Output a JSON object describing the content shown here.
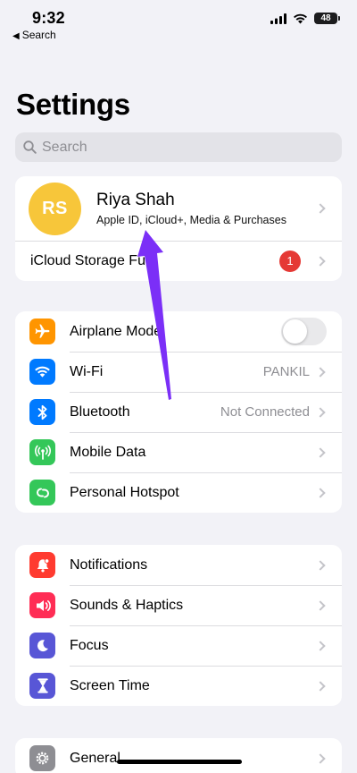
{
  "status_bar": {
    "time": "9:32",
    "back_label": "Search",
    "battery": "48",
    "icons": [
      "signal-icon",
      "wifi-icon",
      "battery-icon"
    ]
  },
  "page": {
    "title": "Settings",
    "search_placeholder": "Search"
  },
  "profile": {
    "initials": "RS",
    "name": "Riya Shah",
    "subtitle": "Apple ID, iCloud+, Media & Purchases",
    "avatar_color": "#f7c63a"
  },
  "icloud": {
    "label": "iCloud Storage Full",
    "badge": "1",
    "badge_color": "#e53935"
  },
  "group1": [
    {
      "label": "Airplane Mode",
      "icon": "airplane-icon",
      "color": "#ff9500",
      "toggle": false
    },
    {
      "label": "Wi-Fi",
      "icon": "wifi-icon",
      "color": "#007aff",
      "value": "PANKIL"
    },
    {
      "label": "Bluetooth",
      "icon": "bluetooth-icon",
      "color": "#007aff",
      "value": "Not Connected"
    },
    {
      "label": "Mobile Data",
      "icon": "antenna-icon",
      "color": "#34c759"
    },
    {
      "label": "Personal Hotspot",
      "icon": "hotspot-icon",
      "color": "#34c759"
    }
  ],
  "group2": [
    {
      "label": "Notifications",
      "icon": "bell-icon",
      "color": "#ff3b30"
    },
    {
      "label": "Sounds & Haptics",
      "icon": "speaker-icon",
      "color": "#ff2d55"
    },
    {
      "label": "Focus",
      "icon": "moon-icon",
      "color": "#5856d6"
    },
    {
      "label": "Screen Time",
      "icon": "hourglass-icon",
      "color": "#5856d6"
    }
  ],
  "group3": [
    {
      "label": "General",
      "icon": "gear-icon",
      "color": "#8e8e93"
    }
  ],
  "annotation": {
    "icon": "pointer-arrow-icon",
    "color": "#7b2ff7"
  }
}
